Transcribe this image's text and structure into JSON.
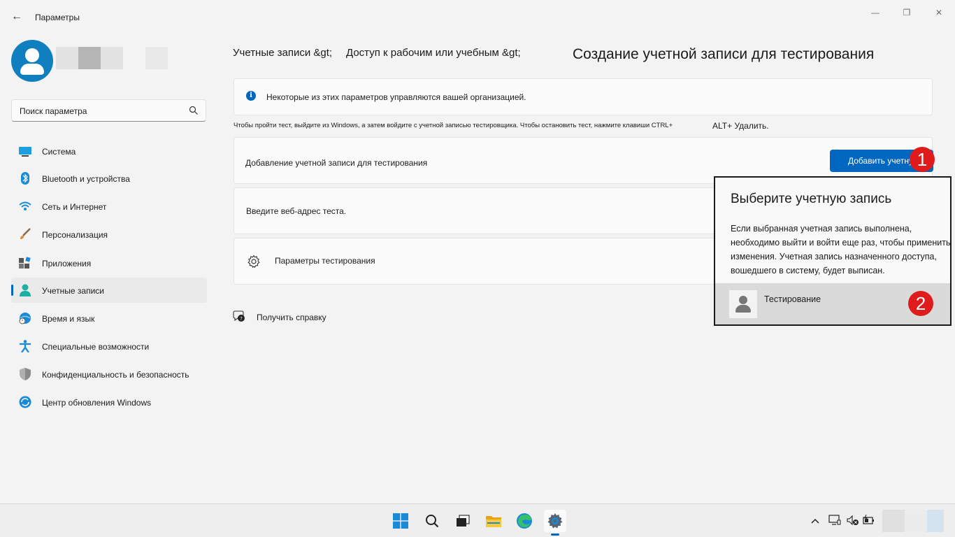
{
  "window": {
    "title": "Параметры",
    "back_icon": "←",
    "minimize_icon": "—",
    "maximize_icon": "❐",
    "close_icon": "✕"
  },
  "search": {
    "placeholder": "Поиск параметра"
  },
  "sidebar": {
    "items": [
      {
        "label": "Система",
        "icon": "system-icon"
      },
      {
        "label": "Bluetooth и устройства",
        "icon": "bluetooth-icon"
      },
      {
        "label": "Сеть и Интернет",
        "icon": "wifi-icon"
      },
      {
        "label": "Персонализация",
        "icon": "brush-icon"
      },
      {
        "label": "Приложения",
        "icon": "apps-icon"
      },
      {
        "label": "Учетные записи",
        "icon": "accounts-icon",
        "active": true
      },
      {
        "label": "Время и язык",
        "icon": "time-language-icon"
      },
      {
        "label": "Специальные возможности",
        "icon": "accessibility-icon"
      },
      {
        "label": "Конфиденциальность и безопасность",
        "icon": "shield-icon"
      },
      {
        "label": "Центр обновления Windows",
        "icon": "update-icon"
      }
    ]
  },
  "breadcrumb": {
    "part1": "Учетные записи &gt;",
    "part2": "Доступ к рабочим или учебным &gt;",
    "current": "Создание учетной записи для тестирования"
  },
  "info_banner": {
    "text": "Некоторые из этих параметров управляются вашей организацией."
  },
  "hint": {
    "text": "Чтобы пройти тест, выйдите из Windows, а затем войдите с учетной записью тестировщика. Чтобы остановить тест, нажмите клавиши CTRL+",
    "text_tail": "ALT+ Удалить."
  },
  "add_account": {
    "label": "Добавление учетной записи для тестирования",
    "button": "Добавить учетную запись"
  },
  "test_url": {
    "label": "Введите веб-адрес теста."
  },
  "test_settings": {
    "label": "Параметры тестирования"
  },
  "help": {
    "label": "Получить справку"
  },
  "markers": {
    "one": "1",
    "two": "2"
  },
  "popup": {
    "title": "Выберите учетную запись",
    "lines": [
      "Если выбранная учетная запись выполнена,",
      "необходимо выйти и войти еще раз, чтобы применить",
      "изменения. Учетная запись назначенного доступа,",
      "вошедшего в систему, будет выписан."
    ],
    "account_name": "Тестирование"
  },
  "colors": {
    "accent": "#0067c0",
    "marker": "#e01b1b"
  }
}
